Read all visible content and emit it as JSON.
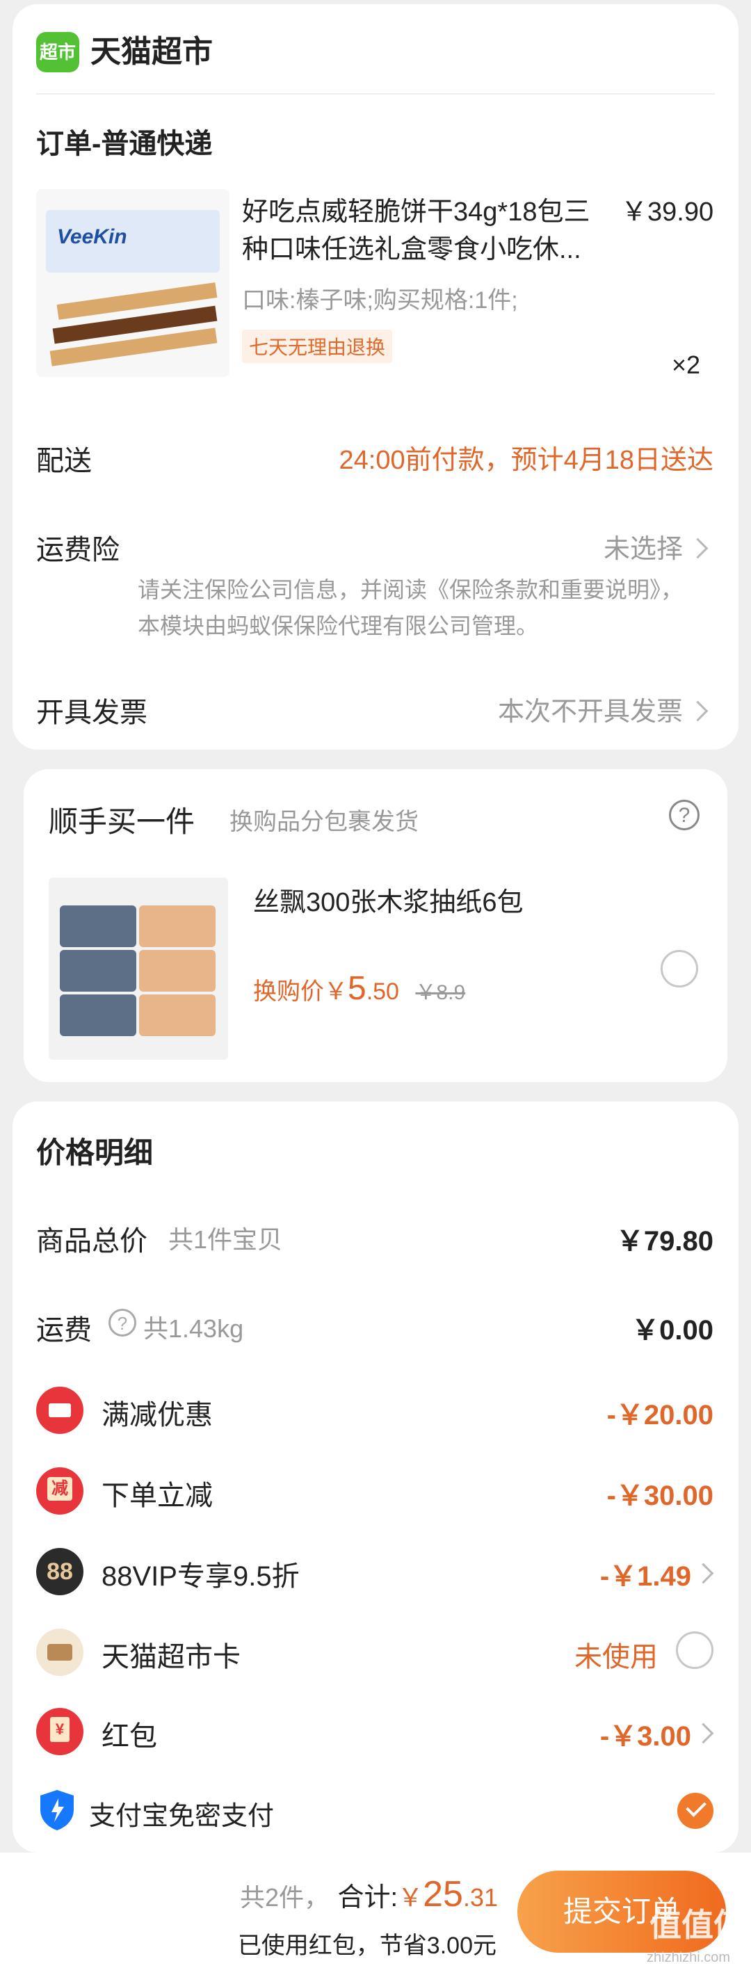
{
  "store": {
    "name": "天猫超市",
    "logo_text": "超市"
  },
  "order": {
    "title": "订单-普通快递",
    "product": {
      "name": "好吃点威轻脆饼干34g*18包三种口味任选礼盒零食小吃休...",
      "price": "￥39.90",
      "spec": "口味:榛子味;购买规格:1件;",
      "tag": "七天无理由退换",
      "qty": "×2",
      "brand_text": "VeeKin"
    },
    "delivery": {
      "label": "配送",
      "value": "24:00前付款，预计4月18日送达"
    },
    "insurance": {
      "label": "运费险",
      "value": "未选择",
      "note": "请关注保险公司信息，并阅读《保险条款和重要说明》，本模块由蚂蚁保保险代理有限公司管理。"
    },
    "invoice": {
      "label": "开具发票",
      "value": "本次不开具发票"
    }
  },
  "addon": {
    "title": "顺手买一件",
    "subtitle": "换购品分包裹发货",
    "help": "?",
    "item": {
      "name": "丝飘300张木浆抽纸6包",
      "price_label": "换购价￥",
      "price_int": "5",
      "price_dec": ".50",
      "original": "￥8.9"
    }
  },
  "price": {
    "title": "价格明细",
    "goods": {
      "label": "商品总价",
      "sub": "共1件宝贝",
      "value": "￥79.80"
    },
    "shipping": {
      "label": "运费",
      "help": "?",
      "sub": "共1.43kg",
      "value": "￥0.00"
    },
    "discounts": [
      {
        "label": "满减优惠",
        "value": "-￥20.00",
        "icon": "ticket-icon",
        "color": "#e8343b"
      },
      {
        "label": "下单立减",
        "value": "-￥30.00",
        "icon": "jian-icon",
        "color": "#e8343b",
        "glyph": "减"
      },
      {
        "label": "88VIP专享9.5折",
        "value": "-￥1.49",
        "icon": "vip88-icon",
        "color": "#2b2b2b",
        "glyph": "88"
      },
      {
        "label": "天猫超市卡",
        "value": "未使用",
        "icon": "card-icon",
        "color": "#f3e6d2"
      },
      {
        "label": "红包",
        "value": "-￥3.00",
        "icon": "redpacket-icon",
        "color": "#e8343b",
        "glyph": "¥"
      }
    ],
    "alipay": {
      "label": "支付宝免密支付"
    }
  },
  "bottom": {
    "count": "共2件，",
    "total_label": "合计:",
    "currency": "￥",
    "total_int": "25",
    "total_dec": ".31",
    "note": "已使用红包，节省3.00元",
    "submit": "提交订单",
    "watermark": "值值值",
    "watermark_sub": "zhizhizhi.com"
  },
  "colors": {
    "accent": "#e0662a",
    "submit_gradient": [
      "#f7a24a",
      "#f06a1e"
    ]
  }
}
